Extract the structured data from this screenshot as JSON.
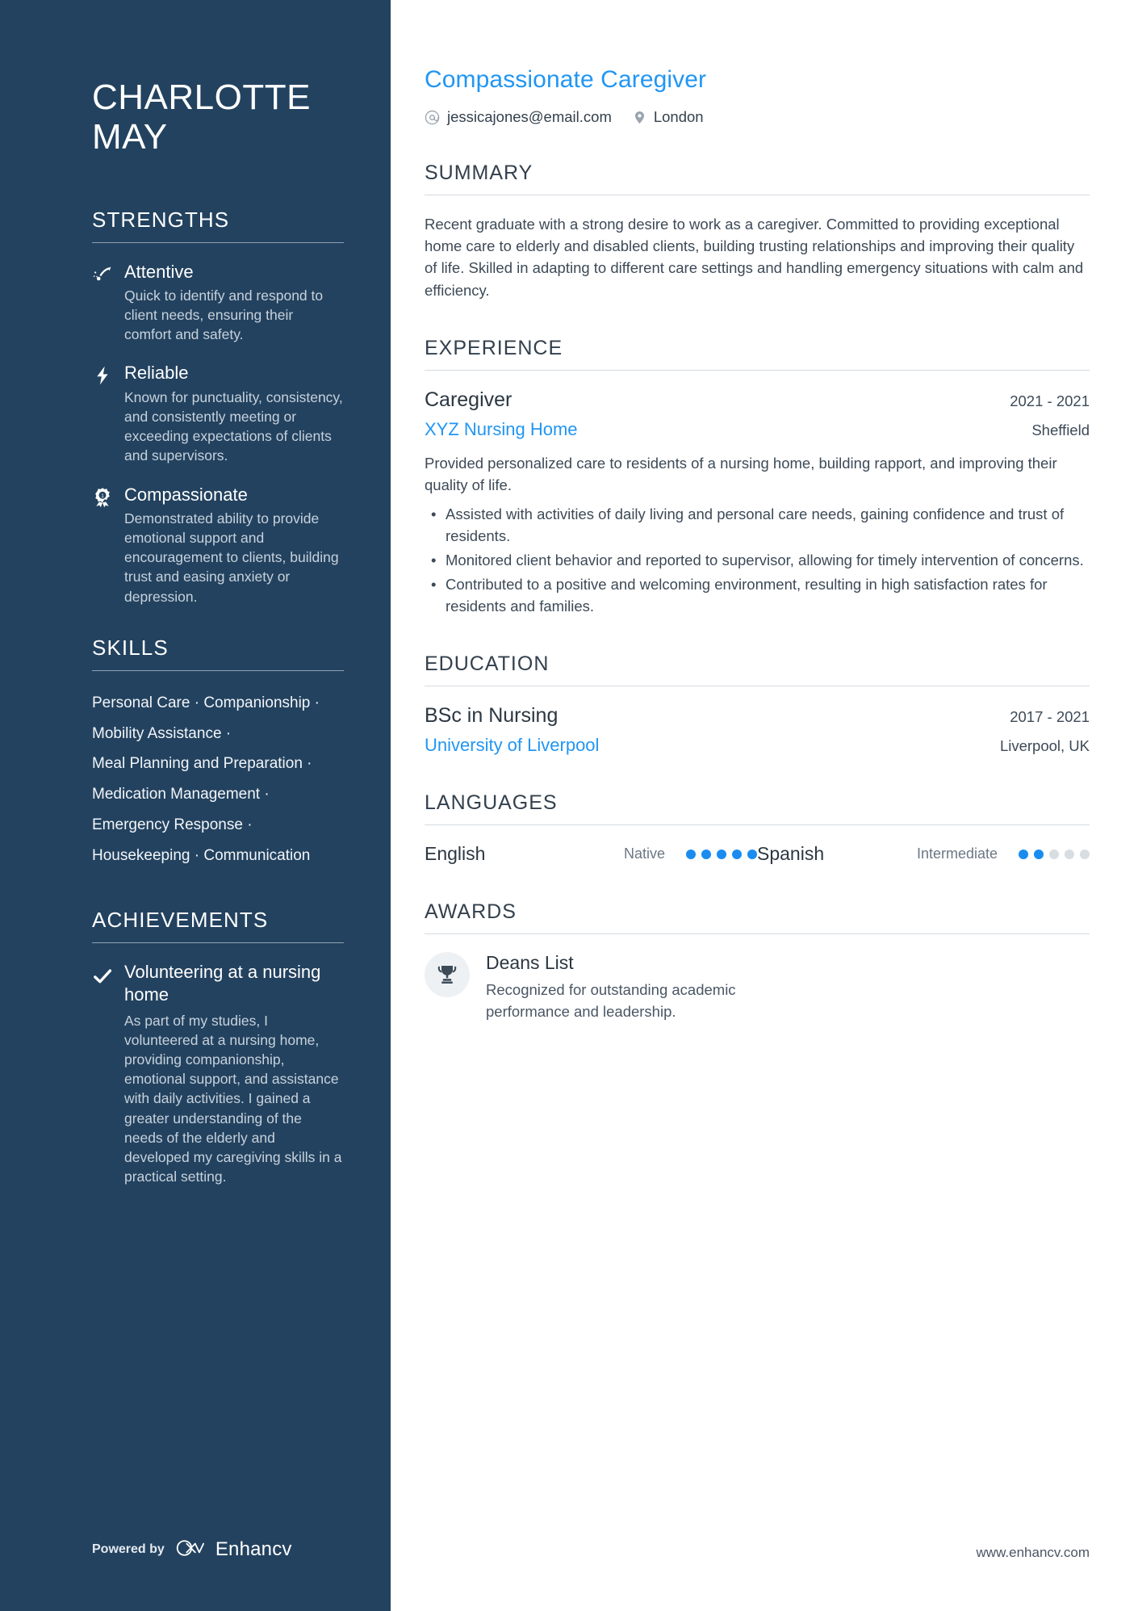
{
  "accent": "#2196f3",
  "sidebar_bg": "#23425f",
  "dot_on": "#1a8cf0",
  "dot_off": "#d8dde2",
  "person": {
    "name": "CHARLOTTE MAY",
    "first_name": "CHARLOTTE",
    "last_name": "MAY"
  },
  "sidebar": {
    "strengths": {
      "heading": "STRENGTHS",
      "items": [
        {
          "icon": "trajectory-arrow-icon",
          "title": "Attentive",
          "description": "Quick to identify and respond to client needs, ensuring their comfort and safety."
        },
        {
          "icon": "lightning-bolt-icon",
          "title": "Reliable",
          "description": "Known for punctuality, consistency, and consistently meeting or exceeding expectations of clients and supervisors."
        },
        {
          "icon": "award-medal-icon",
          "title": "Compassionate",
          "description": "Demonstrated ability to provide emotional support and encouragement to clients, building trust and easing anxiety or depression."
        }
      ]
    },
    "skills": {
      "heading": "SKILLS",
      "separator": "·",
      "rows": [
        [
          "Personal Care",
          "Companionship",
          ""
        ],
        [
          "Mobility Assistance",
          ""
        ],
        [
          "Meal Planning and Preparation",
          ""
        ],
        [
          "Medication Management",
          ""
        ],
        [
          "Emergency Response",
          ""
        ],
        [
          "Housekeeping",
          "Communication"
        ]
      ]
    },
    "achievements": {
      "heading": "ACHIEVEMENTS",
      "items": [
        {
          "icon": "checkmark-icon",
          "title": "Volunteering at a nursing home",
          "description": "As part of my studies, I volunteered at a nursing home, providing companionship, emotional support, and assistance with daily activities. I gained a greater understanding of the needs of the elderly and developed my caregiving skills in a practical setting."
        }
      ]
    },
    "footer": {
      "powered_by_label": "Powered by",
      "brand_name": "Enhancv",
      "brand_icon": "enhancv-infinity-logo-icon"
    }
  },
  "main": {
    "job_title": "Compassionate Caregiver",
    "contacts": [
      {
        "icon": "email-at-icon",
        "value": "jessicajones@email.com"
      },
      {
        "icon": "location-pin-icon",
        "value": "London"
      }
    ],
    "summary": {
      "heading": "SUMMARY",
      "text": "Recent graduate with a strong desire to work as a caregiver. Committed to providing exceptional home care to elderly and disabled clients, building trusting relationships and improving their quality of life. Skilled in adapting to different care settings and handling emergency situations with calm and efficiency."
    },
    "experience": {
      "heading": "EXPERIENCE",
      "items": [
        {
          "title": "Caregiver",
          "date": "2021 - 2021",
          "organization": "XYZ Nursing Home",
          "location": "Sheffield",
          "description": "Provided personalized care to residents of a nursing home, building rapport, and improving their quality of life.",
          "bullets": [
            "Assisted with activities of daily living and personal care needs, gaining confidence and trust of residents.",
            "Monitored client behavior and reported to supervisor, allowing for timely intervention of concerns.",
            "Contributed to a positive and welcoming environment, resulting in high satisfaction rates for residents and families."
          ]
        }
      ]
    },
    "education": {
      "heading": "EDUCATION",
      "items": [
        {
          "title": "BSc in Nursing",
          "date": "2017 - 2021",
          "organization": "University of Liverpool",
          "location": "Liverpool, UK"
        }
      ]
    },
    "languages": {
      "heading": "LANGUAGES",
      "max_dots": 5,
      "items": [
        {
          "name": "English",
          "level": "Native",
          "filled": 5
        },
        {
          "name": "Spanish",
          "level": "Intermediate",
          "filled": 2
        }
      ]
    },
    "awards": {
      "heading": "AWARDS",
      "items": [
        {
          "icon": "trophy-icon",
          "title": "Deans List",
          "description": "Recognized for outstanding academic performance and leadership."
        }
      ]
    },
    "footer": {
      "website": "www.enhancv.com"
    }
  }
}
